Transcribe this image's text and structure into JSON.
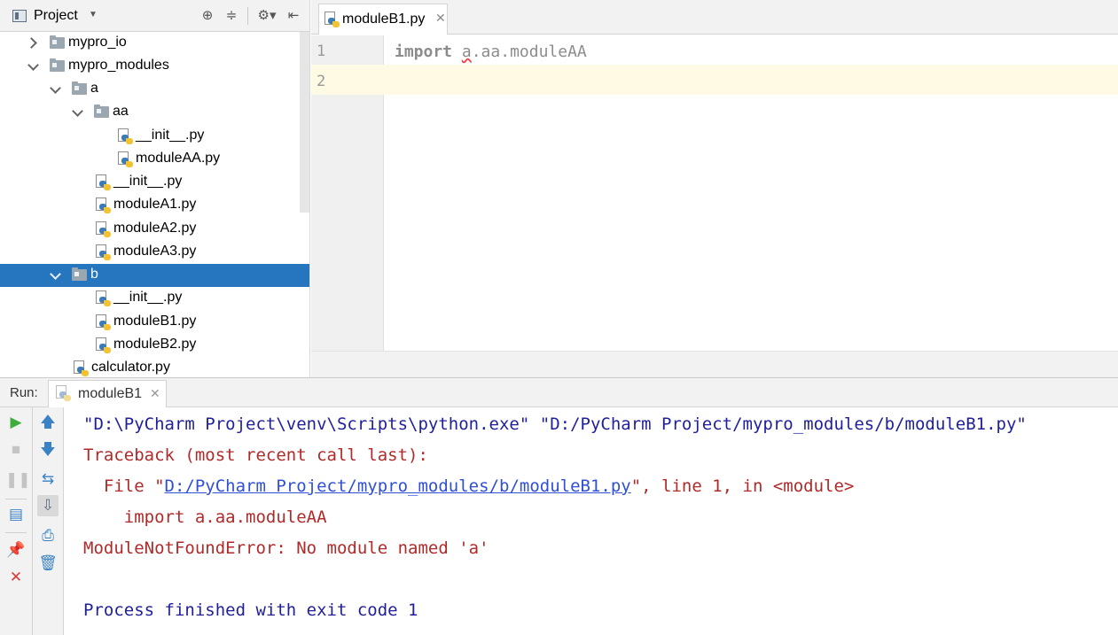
{
  "project_panel": {
    "title": "Project",
    "tree": [
      {
        "label": "mypro_io",
        "type": "folder",
        "expanded": false
      },
      {
        "label": "mypro_modules",
        "type": "folder",
        "expanded": true
      },
      {
        "label": "a",
        "type": "folder",
        "expanded": true
      },
      {
        "label": "aa",
        "type": "folder",
        "expanded": true
      },
      {
        "label": "__init__.py",
        "type": "py"
      },
      {
        "label": "moduleAA.py",
        "type": "py"
      },
      {
        "label": "__init__.py",
        "type": "py"
      },
      {
        "label": "moduleA1.py",
        "type": "py"
      },
      {
        "label": "moduleA2.py",
        "type": "py"
      },
      {
        "label": "moduleA3.py",
        "type": "py"
      },
      {
        "label": "b",
        "type": "folder",
        "expanded": true,
        "selected": true
      },
      {
        "label": "__init__.py",
        "type": "py"
      },
      {
        "label": "moduleB1.py",
        "type": "py"
      },
      {
        "label": "moduleB2.py",
        "type": "py"
      },
      {
        "label": "calculator.py",
        "type": "py"
      }
    ]
  },
  "editor": {
    "tab_label": "moduleB1.py",
    "line_numbers": [
      "1",
      "2"
    ],
    "code": {
      "keyword": "import",
      "module_first": "a",
      "module_rest": ".aa.moduleAA"
    }
  },
  "run_panel": {
    "label": "Run:",
    "tab_label": "moduleB1",
    "console": {
      "command": "\"D:\\PyCharm Project\\venv\\Scripts\\python.exe\" \"D:/PyCharm Project/mypro_modules/b/moduleB1.py\"",
      "traceback_header": "Traceback (most recent call last):",
      "file_prefix": "  File \"",
      "file_link": "D:/PyCharm Project/mypro_modules/b/moduleB1.py",
      "file_suffix": "\", line 1, in <module>",
      "code_line": "    import a.aa.moduleAA",
      "error": "ModuleNotFoundError: No module named 'a'",
      "finished": "Process finished with exit code 1"
    }
  },
  "colors": {
    "selection": "#2675bf",
    "console_error": "#b02a2a",
    "console_command": "#1f1f9c",
    "run_green": "#3dae3d",
    "stop_red": "#d83b3b",
    "tool_blue": "#3b82c4"
  }
}
